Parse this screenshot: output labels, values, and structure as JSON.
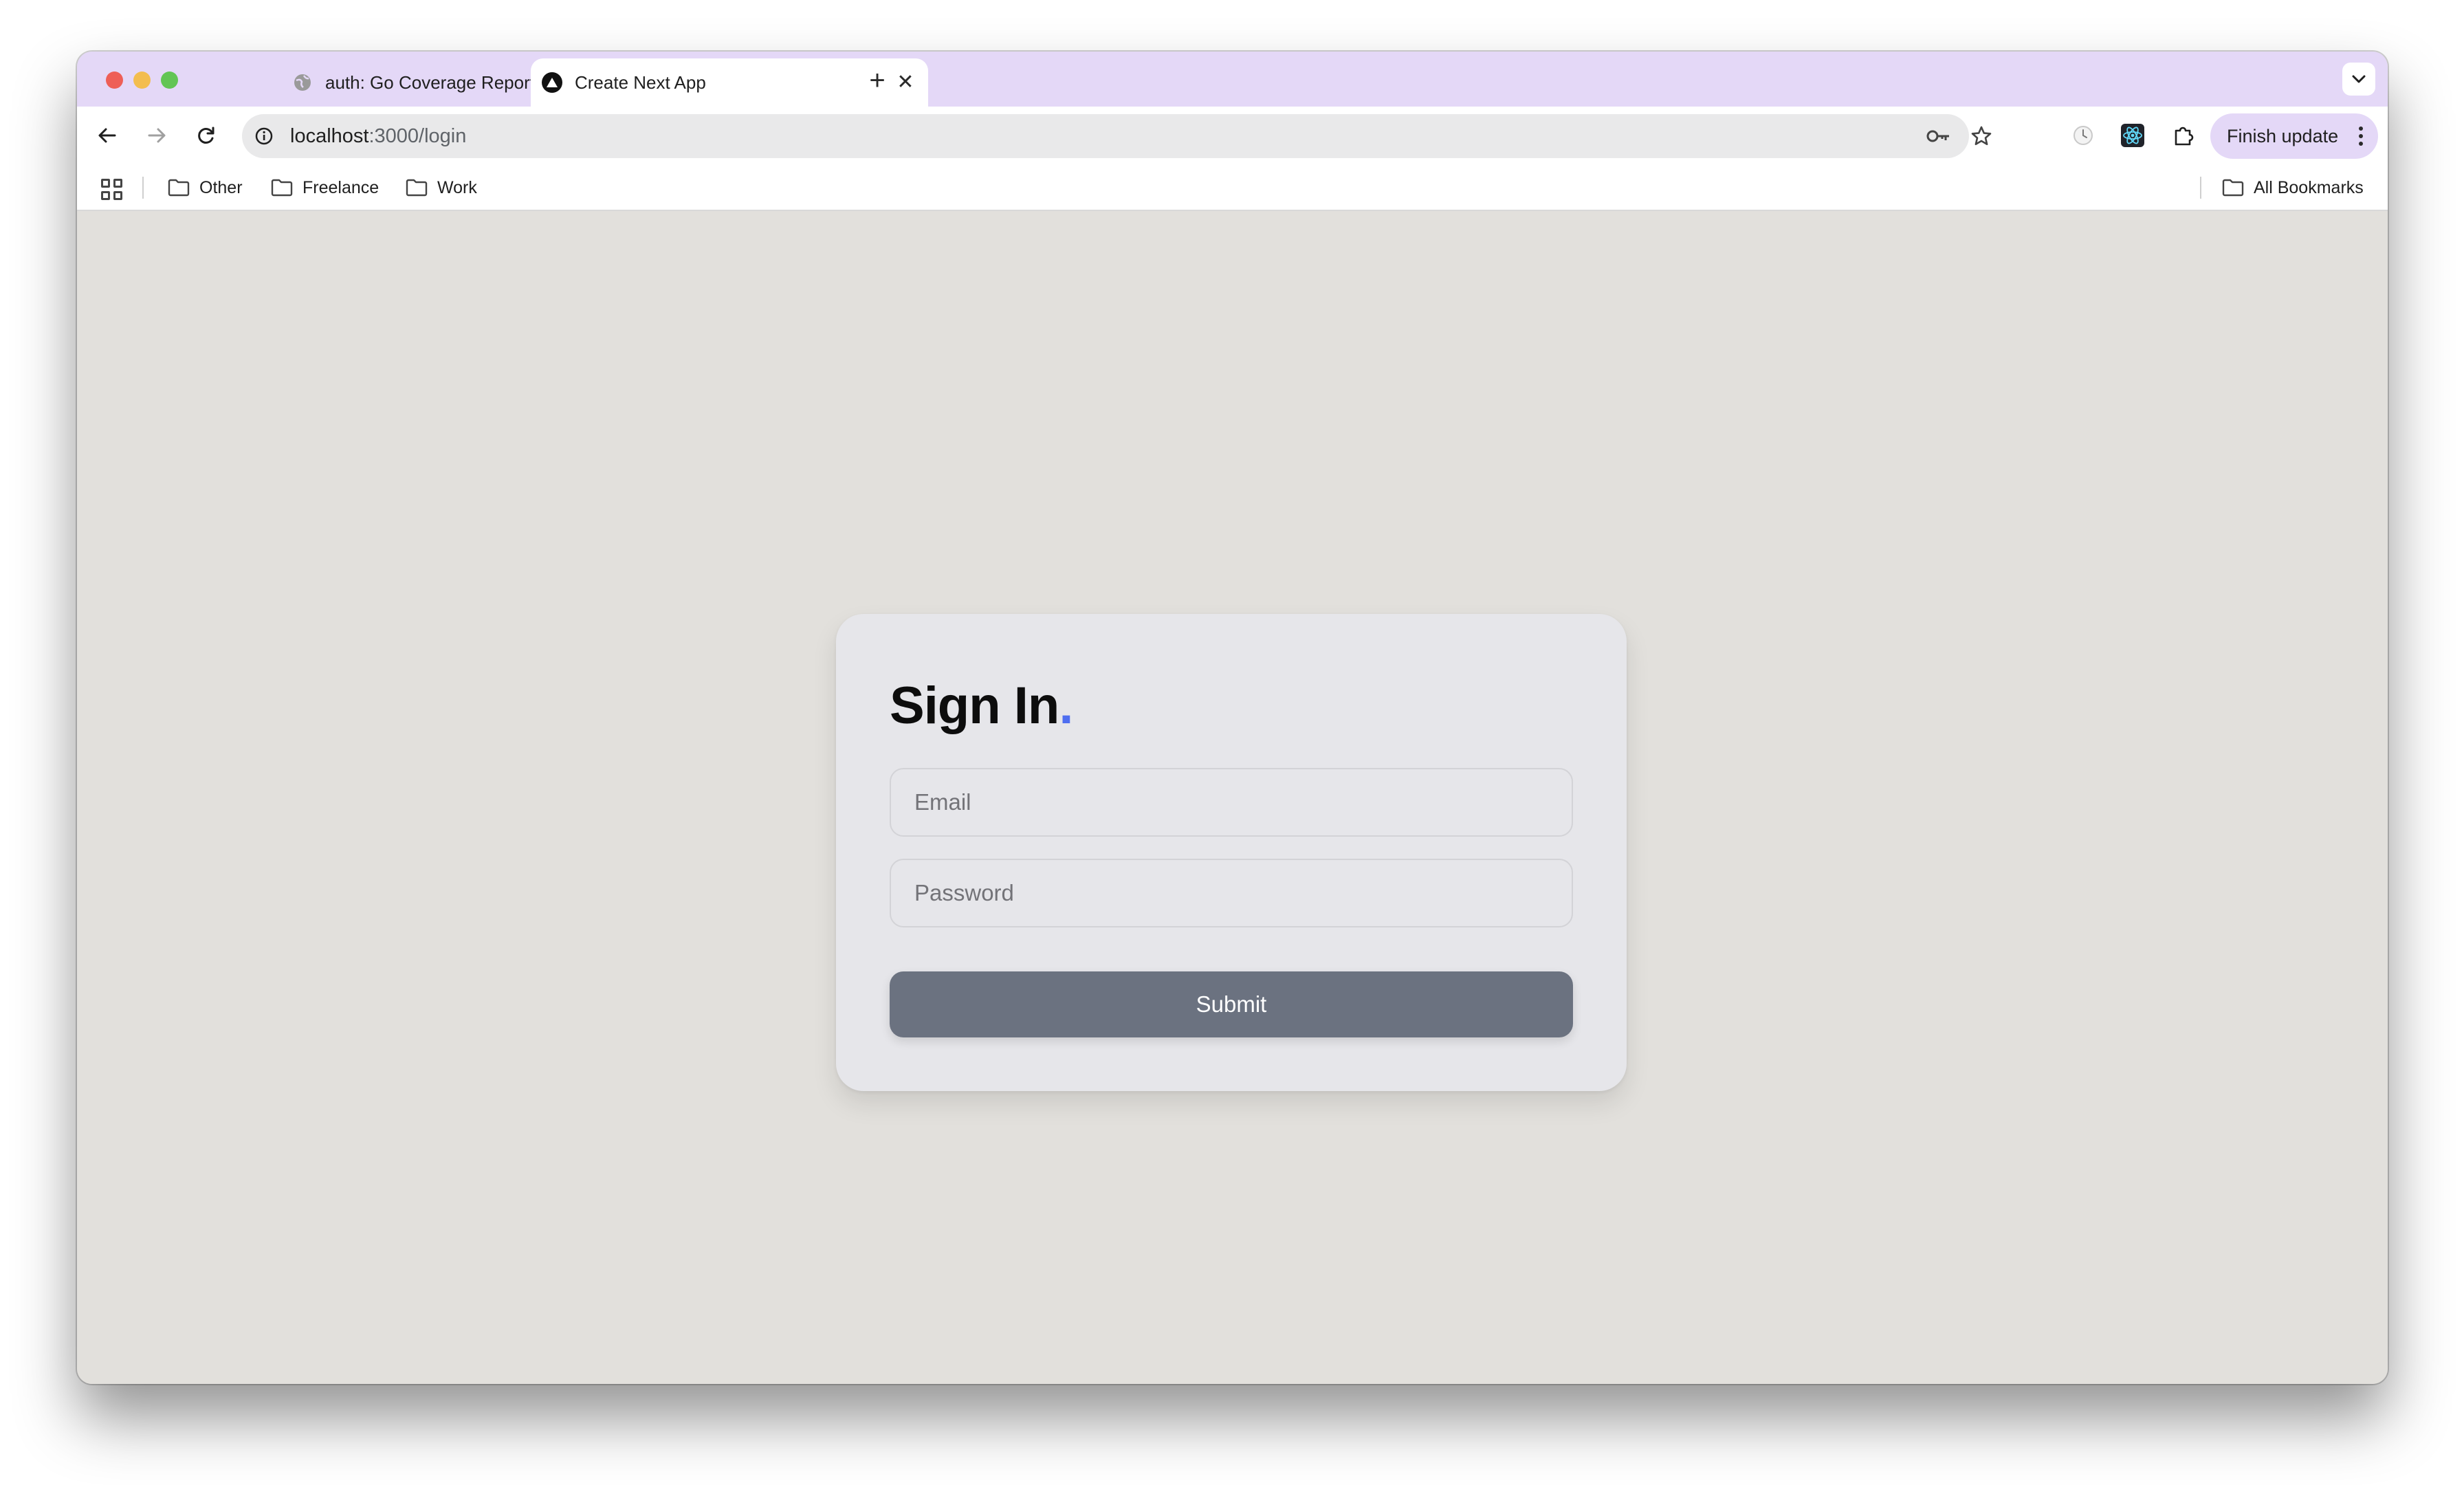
{
  "browser": {
    "tabs": [
      {
        "title": "auth: Go Coverage Report",
        "active": false
      },
      {
        "title": "Create Next App",
        "active": true
      }
    ],
    "new_tab_symbol": "+",
    "close_symbol": "✕",
    "url_host": "localhost",
    "url_path": ":3000/login",
    "finish_update_label": "Finish update",
    "accent_color": "#e4d8f7"
  },
  "bookmarks": {
    "items": [
      {
        "label": "Other",
        "icon": "folder-icon"
      },
      {
        "label": "Freelance",
        "icon": "folder-icon"
      },
      {
        "label": "Work",
        "icon": "folder-icon"
      }
    ],
    "all_bookmarks_label": "All Bookmarks"
  },
  "login": {
    "title": "Sign In",
    "title_dot": ".",
    "title_dot_color": "#4f6ef0",
    "email_placeholder": "Email",
    "password_placeholder": "Password",
    "submit_label": "Submit",
    "submit_color": "#6b7280"
  }
}
